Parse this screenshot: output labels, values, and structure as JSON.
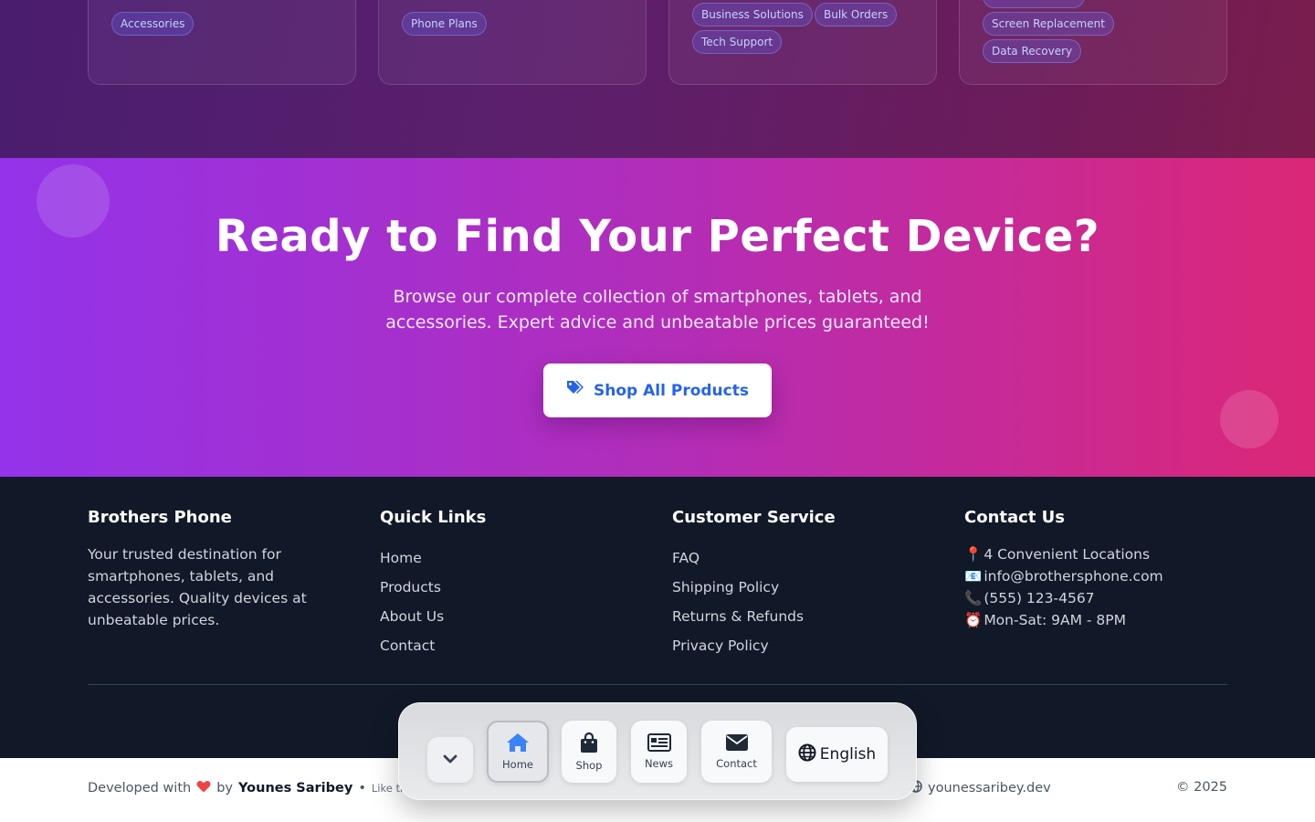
{
  "categories": {
    "card1": {
      "tags": [
        "Accessories"
      ]
    },
    "card2": {
      "tags": [
        "Phone Plans"
      ]
    },
    "card3": {
      "tags": [
        "Business Solutions",
        "Bulk Orders",
        "Tech Support"
      ]
    },
    "card4": {
      "tags": [
        "Screen Replacement",
        "Data Recovery"
      ]
    }
  },
  "cta": {
    "title": "Ready to Find Your Perfect Device?",
    "subtitle": "Browse our complete collection of smartphones, tablets, and accessories. Expert advice and unbeatable prices guaranteed!",
    "button_label": "Shop All Products",
    "button_icon": "tags-icon",
    "button_color": "#2563eb",
    "gradient_start": "#9333ea",
    "gradient_end": "#db2777"
  },
  "footer": {
    "brand": {
      "title": "Brothers Phone",
      "description": "Your trusted destination for smartphones, tablets, and accessories. Quality devices at unbeatable prices."
    },
    "quick_links": {
      "title": "Quick Links",
      "links": [
        "Home",
        "Products",
        "About Us",
        "Contact"
      ]
    },
    "customer_service": {
      "title": "Customer Service",
      "links": [
        "FAQ",
        "Shipping Policy",
        "Returns & Refunds",
        "Privacy Policy"
      ]
    },
    "contact": {
      "title": "Contact Us",
      "lines": [
        {
          "icon": "📍",
          "text": "4 Convenient Locations"
        },
        {
          "icon": "📧",
          "text": "info@brothersphone.com"
        },
        {
          "icon": "📞",
          "text": "(555) 123-4567"
        },
        {
          "icon": "⏰",
          "text": "Mon-Sat: 9AM - 8PM"
        }
      ]
    }
  },
  "bottom_bar": {
    "developed_with": "Developed with",
    "by": "by",
    "author": "Younes Saribey",
    "separator": "•",
    "like_text": "Like this",
    "website": "younessaribey.dev",
    "copyright": "© 2025"
  },
  "dock": {
    "items": [
      {
        "label": "Home",
        "icon": "home-icon",
        "active": true
      },
      {
        "label": "Shop",
        "icon": "shopping-bag-icon"
      },
      {
        "label": "News",
        "icon": "newspaper-icon"
      },
      {
        "label": "Contact",
        "icon": "envelope-icon"
      }
    ],
    "language": "English",
    "active_color": "#3b82f6"
  }
}
